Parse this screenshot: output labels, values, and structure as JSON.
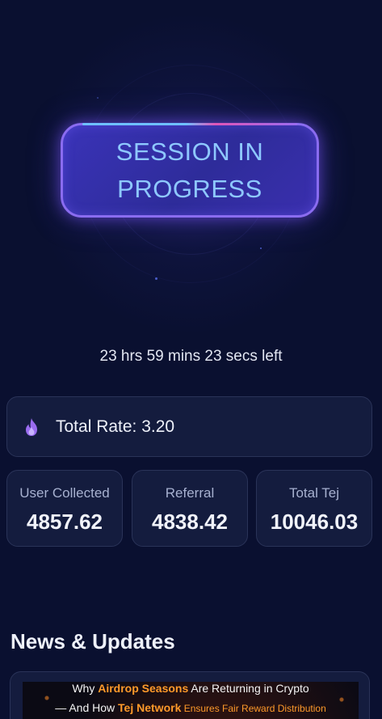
{
  "session": {
    "label": "SESSION IN PROGRESS"
  },
  "timer": {
    "text": "23 hrs 59 mins 23 secs left"
  },
  "rate": {
    "label": "Total Rate: 3.20",
    "icon": "fire-icon"
  },
  "stats": [
    {
      "label": "User Collected",
      "value": "4857.62"
    },
    {
      "label": "Referral",
      "value": "4838.42"
    },
    {
      "label": "Total Tej",
      "value": "10046.03"
    }
  ],
  "news": {
    "title": "News & Updates",
    "headline_part1": "Why ",
    "headline_highlight": "Airdrop Seasons",
    "headline_part2": " Are Returning in Crypto",
    "headline2_part1": "— And How ",
    "headline2_highlight": "Tej Network",
    "headline2_part2": " Ensures Fair Reward Distribution"
  },
  "colors": {
    "background": "#0a1030",
    "card": "#141c3e",
    "accent": "#8a6cf0",
    "button_text": "#8ec8ff",
    "highlight": "#ff9a2a"
  }
}
